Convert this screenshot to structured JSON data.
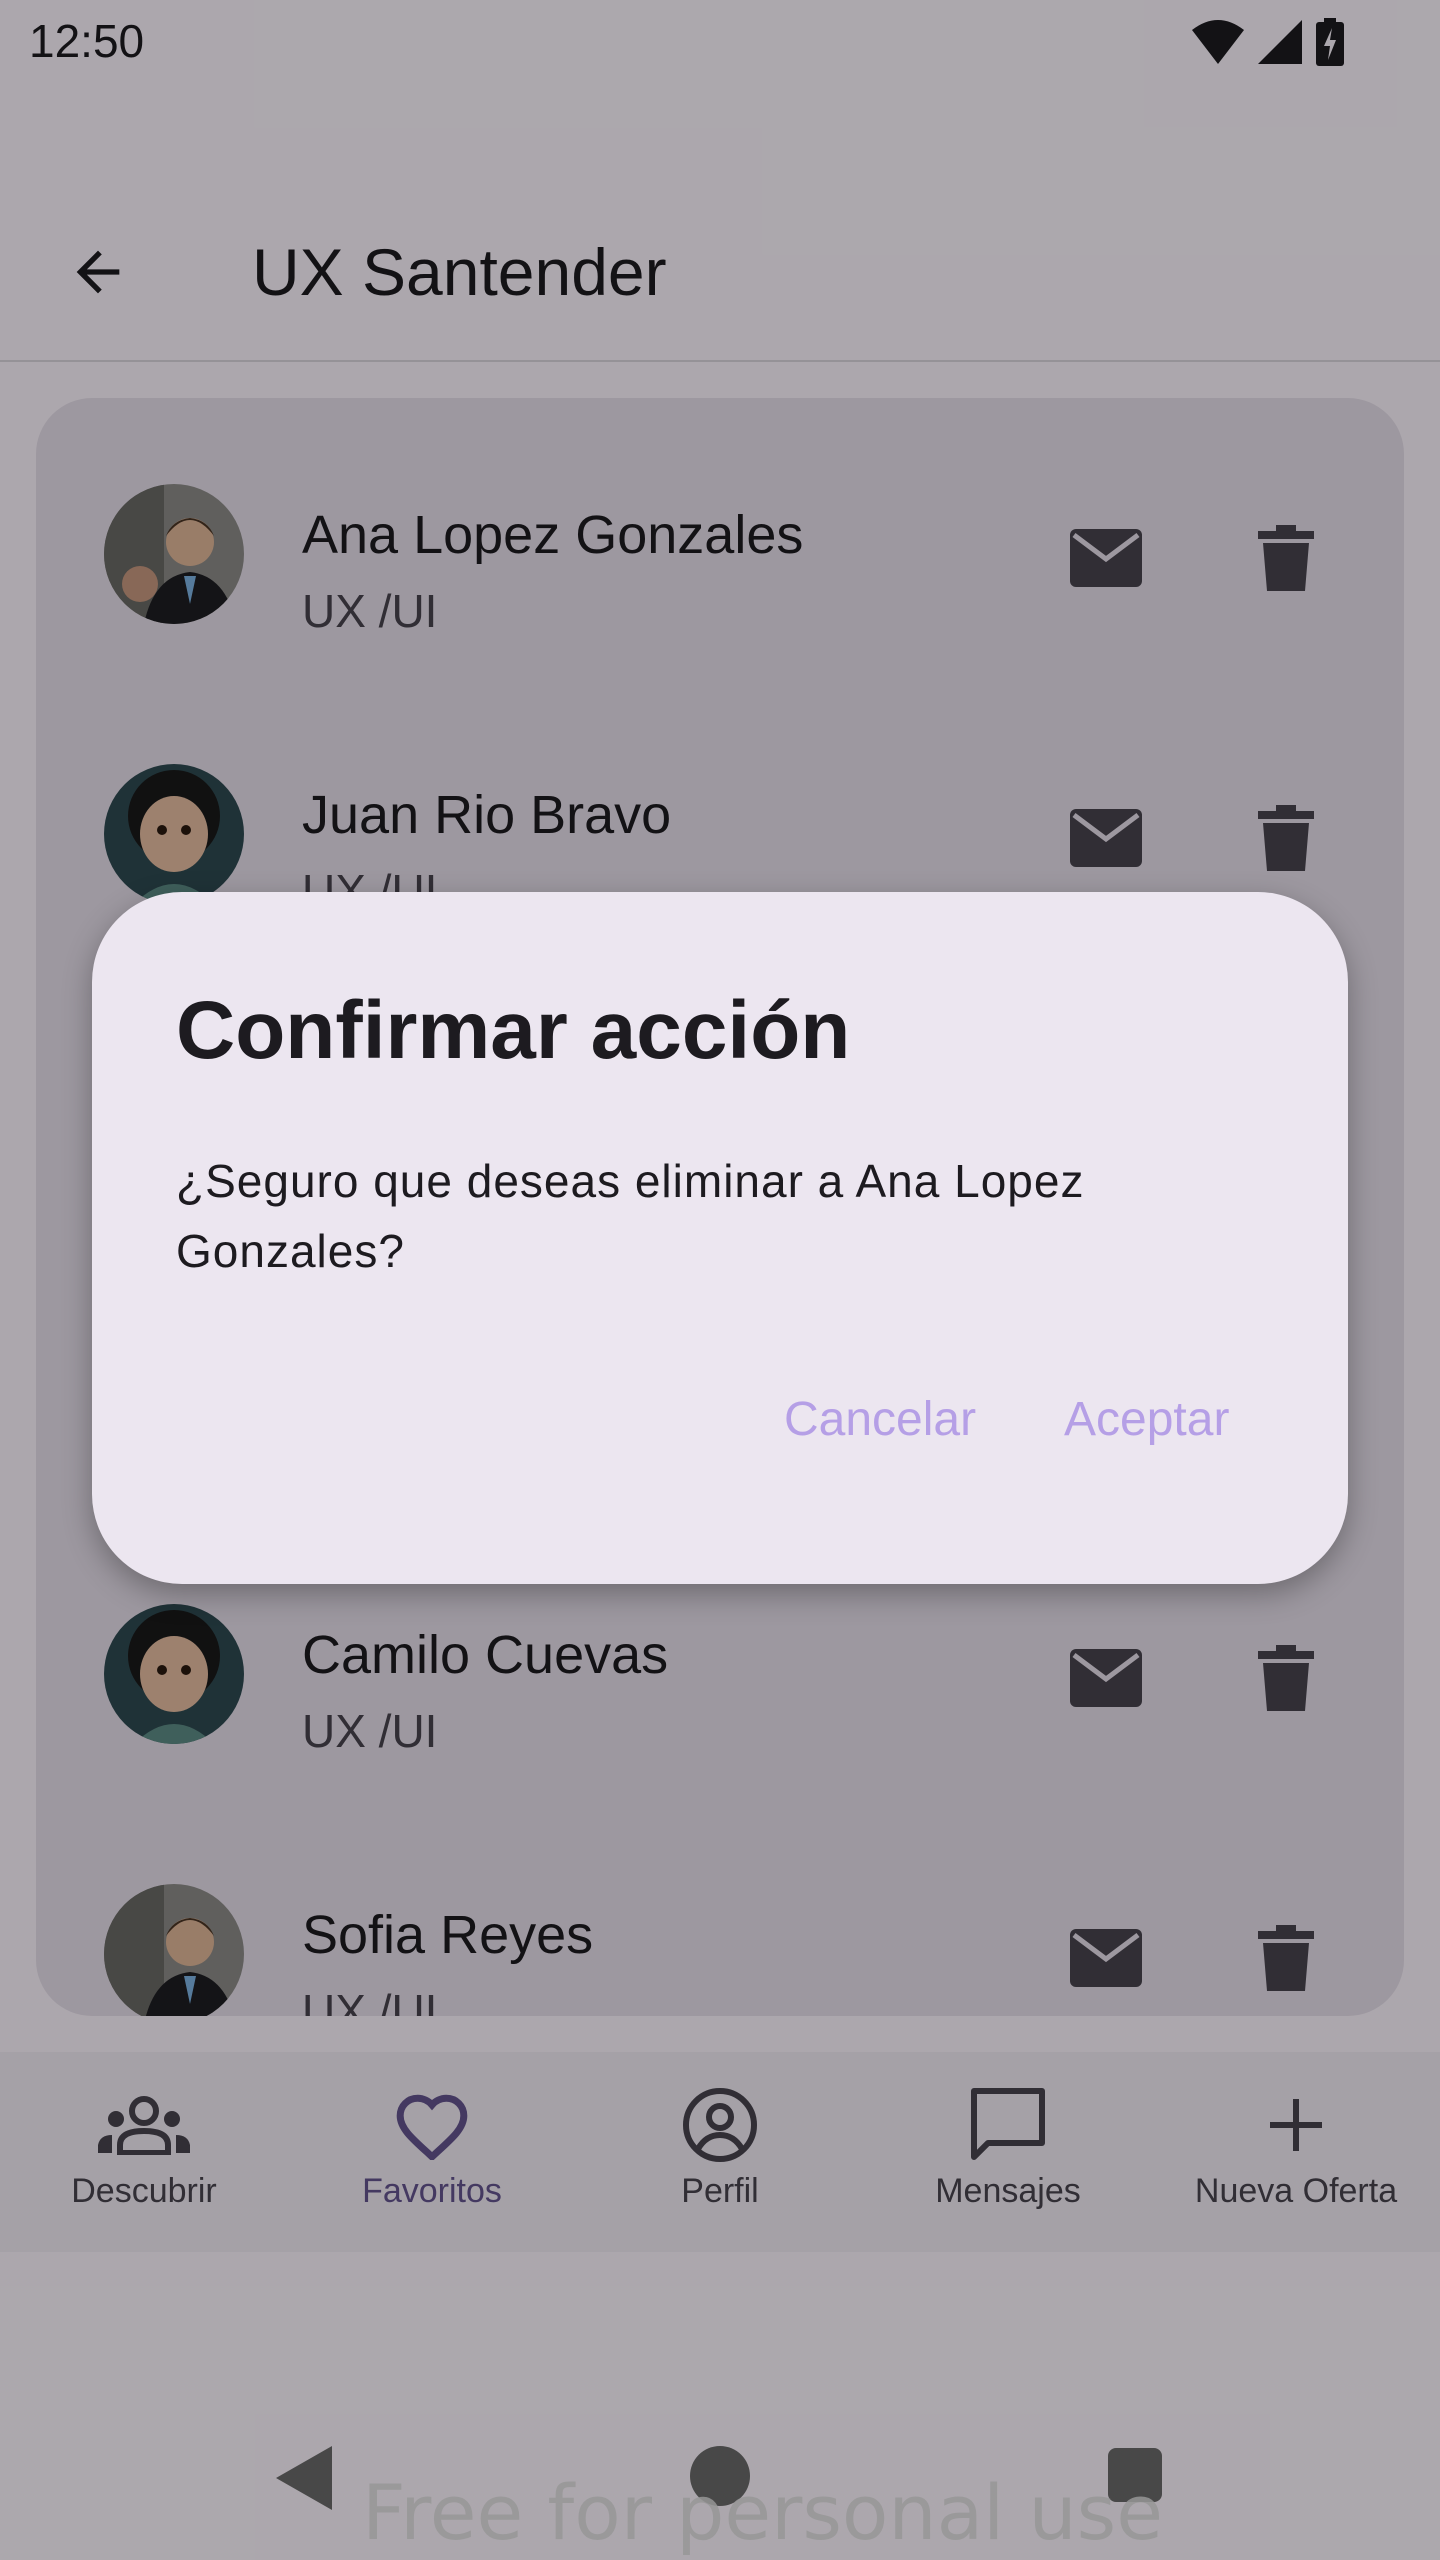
{
  "status_bar": {
    "time": "12:50"
  },
  "app_bar": {
    "title": "UX Santender"
  },
  "contacts": [
    {
      "name": "Ana Lopez Gonzales",
      "role": "UX /UI"
    },
    {
      "name": "Juan Rio Bravo",
      "role": "UX /UI"
    },
    {
      "name": "Camilo Cuevas",
      "role": "UX /UI"
    },
    {
      "name": "Sofia Reyes",
      "role": "UX /UI"
    }
  ],
  "bottom_nav": {
    "items": [
      {
        "label": "Descubrir",
        "icon": "groups-icon"
      },
      {
        "label": "Favoritos",
        "icon": "heart-icon",
        "active": true
      },
      {
        "label": "Perfil",
        "icon": "account-circle-icon"
      },
      {
        "label": "Mensajes",
        "icon": "chat-icon"
      },
      {
        "label": "Nueva Oferta",
        "icon": "plus-icon"
      }
    ]
  },
  "dialog": {
    "title": "Confirmar acción",
    "message": "¿Seguro que deseas eliminar a Ana Lopez Gonzales?",
    "cancel_label": "Cancelar",
    "accept_label": "Aceptar"
  },
  "watermark": "Free for personal use",
  "colors": {
    "primary": "#65558f",
    "dialog_button": "#b59fe6",
    "card_bg": "#e8e0ec",
    "dialog_bg": "#ece6f0"
  }
}
